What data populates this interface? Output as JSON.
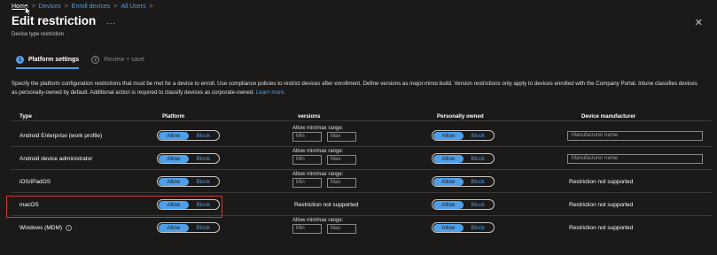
{
  "breadcrumb": {
    "items": [
      "Home",
      "Devices",
      "Enroll devices",
      "All Users"
    ],
    "separator": ">"
  },
  "page": {
    "title": "Edit restriction",
    "more": "...",
    "subtitle": "Device type restriction",
    "close": "✕"
  },
  "steps": [
    {
      "number": "1",
      "label": "Platform settings",
      "active": true
    },
    {
      "number": "2",
      "label": "Review + save",
      "active": false
    }
  ],
  "description": {
    "text": "Specify the platform configuration restrictions that must be met for a device to enroll. Use compliance policies to restrict devices after enrollment. Define versions as major.minor.build. Version restrictions only apply to devices enrolled with the Company Portal. Intune classifies devices as personally-owned by default. Additional action is required to classify devices as corporate-owned.",
    "link": "Learn more."
  },
  "table": {
    "headers": {
      "type": "Type",
      "platform": "Platform",
      "versions": "versions",
      "personally_owned": "Personally owned",
      "manufacturer": "Device manufacturer"
    },
    "toggle": {
      "allow": "Allow",
      "block": "Block"
    },
    "range": {
      "label": "Allow min/max range:",
      "min": "Min",
      "max": "Max"
    },
    "not_supported": "Restriction not supported",
    "manufacturer_placeholder": "Manufacturer name",
    "rows": [
      {
        "type": "Android Enterprise (work profile)",
        "platform": "Allow",
        "versions": "range",
        "personally_owned": "Allow",
        "manufacturer": "input"
      },
      {
        "type": "Android device administrator",
        "platform": "Allow",
        "versions": "range",
        "personally_owned": "Allow",
        "manufacturer": "input"
      },
      {
        "type": "iOS/iPadOS",
        "platform": "Allow",
        "versions": "range",
        "personally_owned": "Allow",
        "manufacturer": "Restriction not supported"
      },
      {
        "type": "macOS",
        "platform": "Allow",
        "versions": "Restriction not supported",
        "personally_owned": "Allow",
        "manufacturer": "Restriction not supported"
      },
      {
        "type": "Windows (MDM)",
        "platform": "Allow",
        "versions": "range",
        "personally_owned": "Allow",
        "manufacturer": "Restriction not supported",
        "info_icon": true
      }
    ]
  },
  "colors": {
    "background": "#1b1a19",
    "accent": "#4f9ee8",
    "highlight": "#d13438"
  }
}
